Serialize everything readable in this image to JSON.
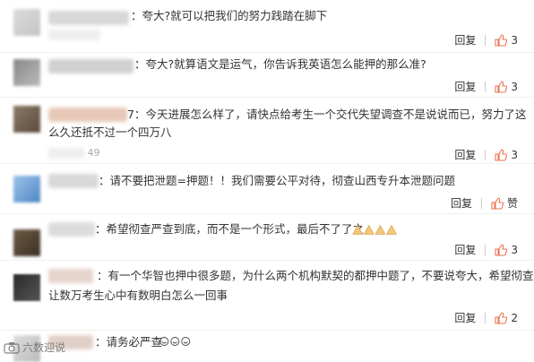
{
  "comments": [
    {
      "text": "：夸大?就可以把我们的努力践踏在脚下",
      "line2": "",
      "reply": "回复",
      "likes": "3",
      "time": ""
    },
    {
      "text": "：夸大?就算语文是运气，你告诉我英语怎么能押的那么准?",
      "line2": "",
      "reply": "回复",
      "likes": "3",
      "time": ""
    },
    {
      "text": "7：今天进展怎么样了，请快点给考生一个交代失望调查不是说说而已，努力了这",
      "line2": "么久还抵不过一个四万八",
      "reply": "回复",
      "likes": "3",
      "time": "49"
    },
    {
      "text": "：请不要把泄题=押题！！我们需要公平对待，彻查山西专升本泄题问题",
      "line2": "",
      "reply": "回复",
      "likes": "赞",
      "time": ""
    },
    {
      "text": "：希望彻查严查到底，而不是一个形式，最后不了了之",
      "line2": "",
      "reply": "回复",
      "likes": "3",
      "time": ""
    },
    {
      "text": "：有一个华智也押中很多题，为什么两个机构默契的都押中题了，不要说夸大，希望彻查，",
      "line2": "让数万考生心中有数明白怎么一回事",
      "reply": "回复",
      "likes": "2",
      "time": ""
    },
    {
      "text": "：请务必严查",
      "line2": "",
      "reply": "回复",
      "likes": "",
      "time": ""
    }
  ],
  "watermark": "六数迎说",
  "colors": {
    "accent": "#eb7350",
    "text": "#333333",
    "muted": "#aaaaaa"
  }
}
